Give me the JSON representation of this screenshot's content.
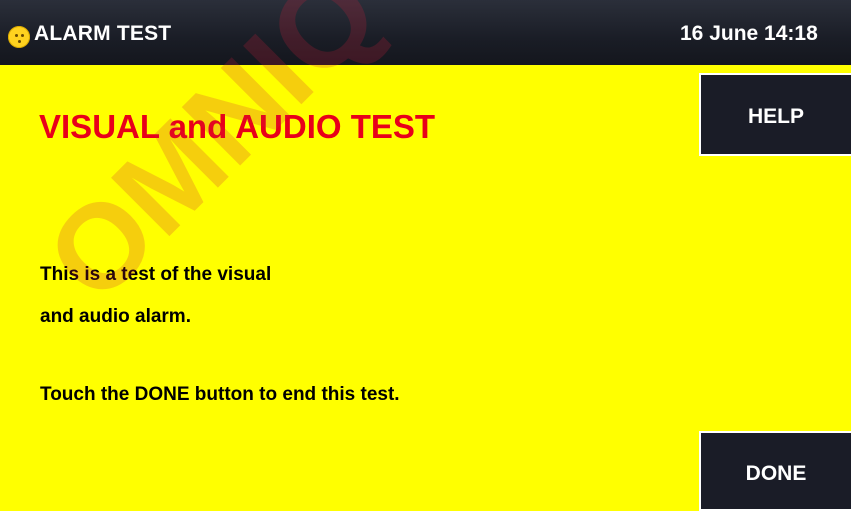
{
  "header": {
    "title": "ALARM TEST",
    "datetime": "16 June 14:18",
    "status_icon": "smiley-face-icon"
  },
  "main": {
    "heading": "VISUAL and AUDIO TEST",
    "instructions": [
      "This is a test of the visual",
      "and audio alarm.",
      "Touch the DONE button to end this test."
    ]
  },
  "buttons": {
    "help_label": "HELP",
    "done_label": "DONE"
  },
  "overlay": {
    "watermark_text": "OMNIQ"
  },
  "colors": {
    "background": "#ffff00",
    "header": "#1a1d26",
    "heading": "#e8001a",
    "button": "#1a1c27"
  }
}
